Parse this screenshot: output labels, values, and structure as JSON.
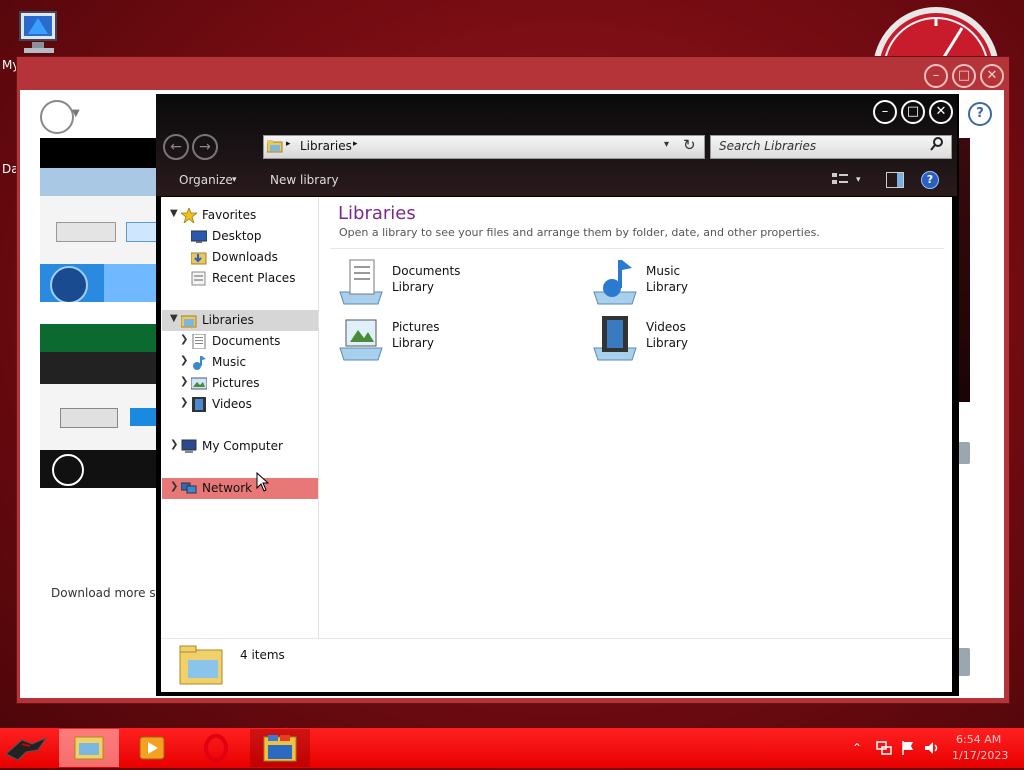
{
  "desktop": {
    "icon_label_partial_1": "My",
    "icon_label_partial_2": "Da"
  },
  "background_window": {
    "download_text": "Download more skin",
    "help": "?"
  },
  "explorer": {
    "window_controls": {
      "minimize": "–",
      "maximize": "□",
      "close": "✕"
    },
    "nav": {
      "back": "←",
      "forward": "→"
    },
    "address": {
      "path": "Libraries",
      "separator": "▸",
      "dropdown": "▾",
      "refresh": "↻"
    },
    "search": {
      "placeholder": "Search Libraries",
      "icon": "search-icon"
    },
    "toolbar": {
      "organize": "Organize",
      "organize_arrow": "▾",
      "new_library": "New library",
      "view_arrow": "▾",
      "help": "?"
    },
    "navigation_pane": {
      "favorites": {
        "label": "Favorites",
        "items": [
          {
            "label": "Desktop"
          },
          {
            "label": "Downloads"
          },
          {
            "label": "Recent Places"
          }
        ]
      },
      "libraries": {
        "label": "Libraries",
        "items": [
          {
            "label": "Documents"
          },
          {
            "label": "Music"
          },
          {
            "label": "Pictures"
          },
          {
            "label": "Videos"
          }
        ]
      },
      "computer": {
        "label": "My Computer"
      },
      "network": {
        "label": "Network"
      }
    },
    "content": {
      "title": "Libraries",
      "subtitle": "Open a library to see your files and arrange them by folder, date, and other properties.",
      "items": [
        {
          "name": "Documents",
          "type": "Library"
        },
        {
          "name": "Music",
          "type": "Library"
        },
        {
          "name": "Pictures",
          "type": "Library"
        },
        {
          "name": "Videos",
          "type": "Library"
        }
      ]
    },
    "details": {
      "count": "4 items"
    }
  },
  "taskbar": {
    "clock_time": "6:54 AM",
    "clock_date": "1/17/2023",
    "tray_chevron": "⌃"
  },
  "colors": {
    "taskbar": "#ff1a1a",
    "library_title": "#7a2b8a",
    "network_highlight": "#e87878",
    "libraries_highlight": "#d6d6d6"
  }
}
